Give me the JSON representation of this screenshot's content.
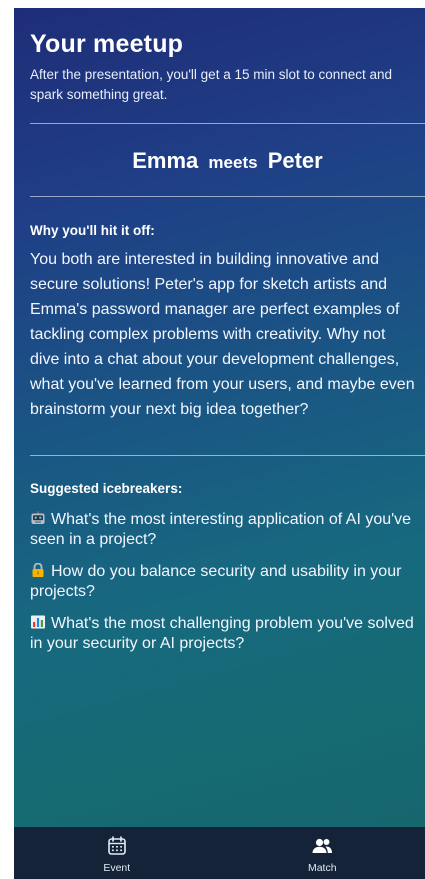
{
  "header": {
    "title": "Your meetup",
    "subtitle": "After the presentation, you'll get a 15 min slot to connect and spark something great."
  },
  "match": {
    "name_a": "Emma",
    "connector": "meets",
    "name_b": "Peter"
  },
  "reason": {
    "label": "Why you'll hit it off:",
    "text": "You both are interested in building innovative and secure solutions! Peter's app for sketch artists and Emma's password manager are perfect examples of tackling complex problems with creativity. Why not dive into a chat about your development challenges, what you've learned from your users, and maybe even brainstorm your next big idea together?"
  },
  "icebreakers": {
    "label": "Suggested icebreakers:",
    "items": [
      {
        "icon": "robot-icon",
        "text": "What's the most interesting application of AI you've seen in a project?"
      },
      {
        "icon": "lock-icon",
        "text": "How do you balance security and usability in your projects?"
      },
      {
        "icon": "bar-chart-icon",
        "text": "What's the most challenging problem you've solved in your security or AI projects?"
      }
    ]
  },
  "nav": {
    "items": [
      {
        "label": "Event",
        "icon": "calendar-icon"
      },
      {
        "label": "Match",
        "icon": "people-icon"
      }
    ]
  },
  "colors": {
    "nav_background": "#142338",
    "gradient_top": "#1f2d78",
    "gradient_bottom": "#15646c"
  }
}
